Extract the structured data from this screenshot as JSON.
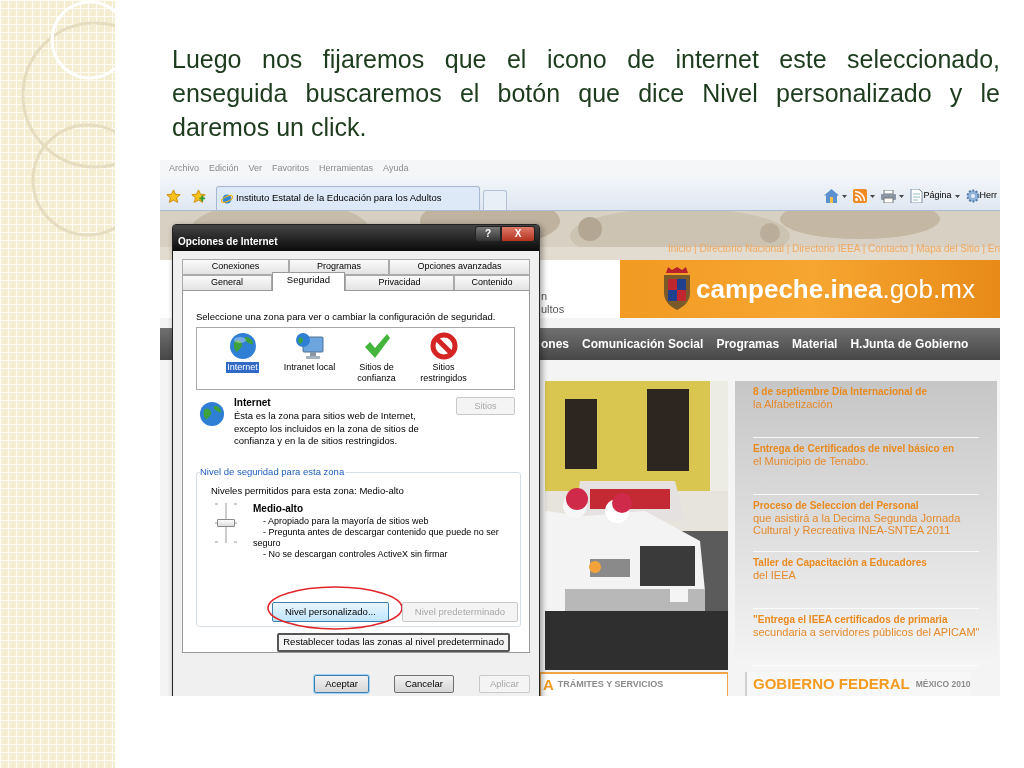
{
  "slide": {
    "title": "Luego nos fijaremos que el icono de internet este seleccionado, enseguida buscaremos el botón que dice Nivel personalizado y le daremos un click."
  },
  "browser": {
    "menu": [
      "Archivo",
      "Edición",
      "Ver",
      "Favoritos",
      "Herramientas",
      "Ayuda"
    ],
    "tab_title": "Instituto Estatal de la Educación para los Adultos",
    "toolbar": [
      {
        "kind": "home"
      },
      {
        "kind": "feeds"
      },
      {
        "kind": "print"
      },
      {
        "kind": "page",
        "label": "Página"
      },
      {
        "kind": "tools",
        "label": "Herr"
      }
    ]
  },
  "webpage": {
    "header_links": "Inicio | Directorio Nacional | Directorio IEEA | Contacto | Mapa del Sitio | En",
    "side_text": [
      "n",
      "ultos"
    ],
    "banner": "**campeche.inea**.gob.mx",
    "nav": [
      "ones",
      "Comunicación Social",
      "Programas",
      "Material",
      "H.Junta de Gobierno"
    ],
    "news": [
      {
        "title": "8 de septiembre Día Internacional de",
        "lines": [
          "la Alfabetización"
        ]
      },
      {
        "title": "Entrega de Certificados de nivel básico en",
        "lines": [
          "el Municipio de Tenabo."
        ]
      },
      {
        "title": "Proceso de Seleccion del Personal",
        "lines": [
          "que asistirá a la Decima Segunda Jornada",
          "Cultural y Recreativa INEA-SNTEA 2011"
        ]
      },
      {
        "title": "Taller de Capacitación a Educadores",
        "lines": [
          "del IEEA"
        ]
      },
      {
        "title": "\"Entrega el IEEA certificados de primaria",
        "lines": [
          "secundaria a servidores públicos del APICAM\""
        ]
      }
    ],
    "services_box": {
      "letter": "A",
      "label": "TRÁMITES Y SERVICIOS"
    },
    "footer_brand": {
      "title": "GOBIERNO FEDERAL",
      "subtitle": "MÉXICO 2010"
    }
  },
  "dialog": {
    "title": "Opciones de Internet",
    "help": "?",
    "close": "X",
    "tab_rows": [
      {
        "tabs": [
          {
            "label": "Conexiones",
            "selected": false
          },
          {
            "label": "Programas",
            "selected": false
          },
          {
            "label": "Opciones avanzadas",
            "selected": false
          }
        ]
      },
      {
        "tabs": [
          {
            "label": "General",
            "selected": false
          },
          {
            "label": "Seguridad",
            "selected": true
          },
          {
            "label": "Privacidad",
            "selected": false
          },
          {
            "label": "Contenido",
            "selected": false
          }
        ]
      }
    ],
    "prompt": "Seleccione una zona para ver o cambiar la configuración de seguridad.",
    "zones": [
      {
        "kind": "internet",
        "label": "Internet",
        "selected": true
      },
      {
        "kind": "intranet",
        "label": "Intranet local",
        "selected": false
      },
      {
        "kind": "trusted",
        "label": "Sitios de confianza",
        "selected": false
      },
      {
        "kind": "restricted",
        "label": "Sitios restringidos",
        "selected": false
      }
    ],
    "zone_info": {
      "name": "Internet",
      "description": "Ésta es la zona para sitios web de Internet, excepto los incluidos en la zona de sitios de confianza y en la de sitios restringidos.",
      "sites_button": {
        "label": "Sitios",
        "disabled": true
      }
    },
    "security": {
      "legend": "Nivel de seguridad para esta zona",
      "allowed": "Niveles permitidos para esta zona: Medio-alto",
      "level": 0.5,
      "level_name": "Medio-alto",
      "details": [
        "- Apropiado para la mayoría de sitios web",
        "- Pregunta antes de descargar contenido que puede no ser seguro",
        "- No se descargan controles ActiveX sin firmar"
      ],
      "buttons": [
        {
          "label": "Nivel personalizado...",
          "disabled": false,
          "highlighted": true,
          "circled": true
        },
        {
          "label": "Nivel predeterminado",
          "disabled": true,
          "highlighted": false,
          "circled": false
        }
      ]
    },
    "reset_button": {
      "label": "Restablecer todas las zonas al nivel predeterminado",
      "disabled": false
    },
    "footer_buttons": [
      {
        "label": "Aceptar",
        "disabled": false,
        "default": true
      },
      {
        "label": "Cancelar",
        "disabled": false,
        "default": false
      },
      {
        "label": "Aplicar",
        "disabled": true,
        "default": false
      }
    ]
  }
}
